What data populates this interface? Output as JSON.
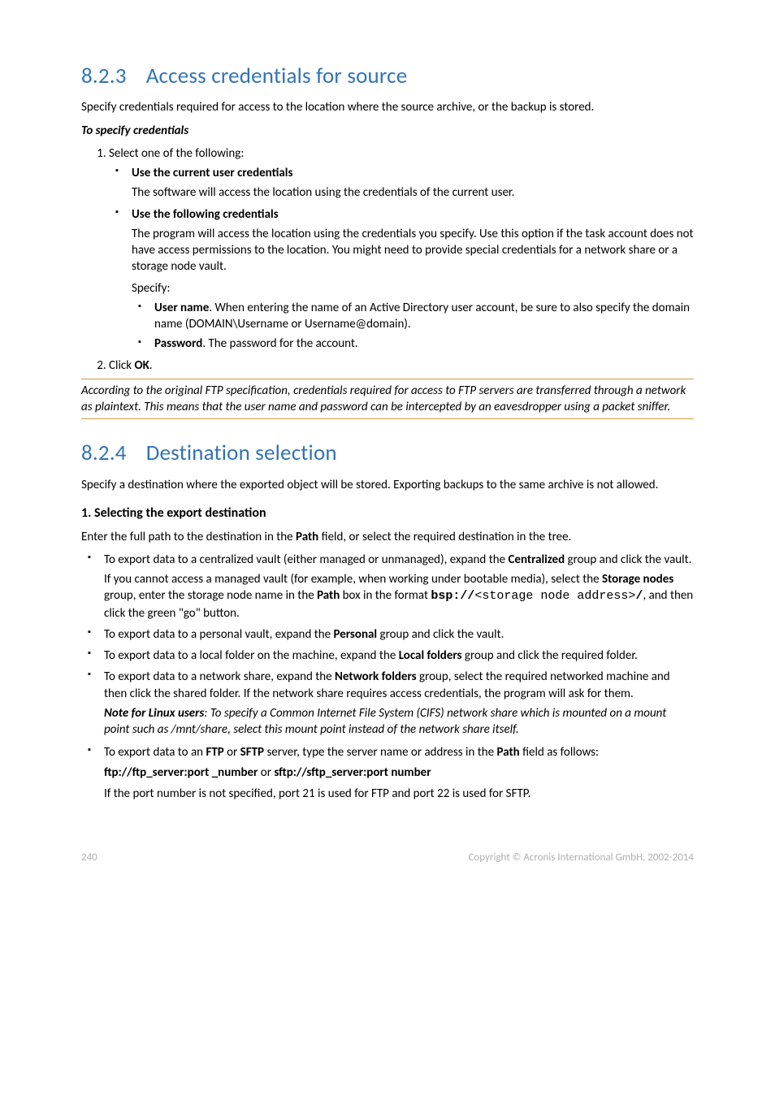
{
  "s823": {
    "heading_num": "8.2.3",
    "heading_text": "Access credentials for source",
    "intro": "Specify credentials required for access to the location where the source archive, or the backup is stored.",
    "to_specify": "To specify credentials",
    "step1": "Select one of the following:",
    "opt1_title": "Use the current user credentials",
    "opt1_body": "The software will access the location using the credentials of the current user.",
    "opt2_title": "Use the following credentials",
    "opt2_body": "The program will access the location using the credentials you specify. Use this option if the task account does not have access permissions to the location. You might need to provide special credentials for a network share or a storage node vault.",
    "specify": "Specify:",
    "username_label": "User name",
    "username_body": ". When entering the name of an Active Directory user account, be sure to also specify the domain name (DOMAIN\\Username or Username@domain).",
    "password_label": "Password",
    "password_body": ". The password for the account.",
    "step2_pre": "Click ",
    "step2_ok": "OK",
    "step2_post": ".",
    "ftp_note": "According to the original FTP specification, credentials required for access to FTP servers are transferred through a network as plaintext. This means that the user name and password can be intercepted by an eavesdropper using a packet sniffer."
  },
  "s824": {
    "heading_num": "8.2.4",
    "heading_text": "Destination selection",
    "intro": "Specify a destination where the exported object will be stored. Exporting backups to the same archive is not allowed.",
    "sub1": "1. Selecting the export destination",
    "path_intro_pre": "Enter the full path to the destination in the ",
    "path_word": "Path",
    "path_intro_post": " field, or select the required destination in the tree.",
    "b1_pre": "To export data to a centralized vault (either managed or unmanaged), expand the ",
    "b1_centralized": "Centralized",
    "b1_post": " group and click the vault.",
    "b1_body_pre": "If you cannot access a managed vault (for example, when working under bootable media), select the ",
    "b1_storage_nodes": "Storage nodes",
    "b1_body_mid1": " group, enter the storage node name in the ",
    "b1_body_mid2": " box in the format ",
    "b1_bsp": "bsp://",
    "b1_mono": "<storage node address>",
    "b1_slash": "/",
    "b1_body_post": ", and then click the green \"go\" button.",
    "b2_pre": "To export data to a personal vault, expand the ",
    "b2_personal": "Personal",
    "b2_post": " group and click the vault.",
    "b3_pre": "To export data to a local folder on the machine, expand the ",
    "b3_local": "Local folders",
    "b3_post": " group and click the required folder.",
    "b4_pre": "To export data to a network share, expand the ",
    "b4_network": "Network folders",
    "b4_post": " group, select the required networked machine and then click the shared folder. If the network share requires access credentials, the program will ask for them.",
    "b4_note_label": "Note for Linux users",
    "b4_note_body": ": To specify a Common Internet File System (CIFS) network share which is mounted on a mount point such as /mnt/share, select this mount point instead of the network share itself.",
    "b5_pre": "To export data to an ",
    "b5_ftp": "FTP",
    "b5_or": " or ",
    "b5_sftp": "SFTP",
    "b5_mid": " server, type the server name or address in the ",
    "b5_post": " field as follows:",
    "b5_format1": "ftp://ftp_server:port _number",
    "b5_format_or": " or ",
    "b5_format2": "sftp://sftp_server:port number",
    "b5_portnote": "If the port number is not specified, port 21 is used for FTP and port 22 is used for SFTP."
  },
  "footer": {
    "page": "240",
    "copyright": "Copyright © Acronis International GmbH, 2002-2014"
  }
}
